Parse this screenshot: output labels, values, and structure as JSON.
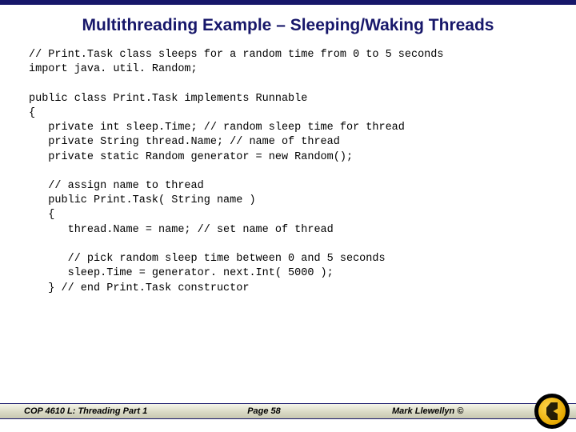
{
  "title": "Multithreading Example – Sleeping/Waking Threads",
  "code": "// Print.Task class sleeps for a random time from 0 to 5 seconds\nimport java. util. Random;\n\npublic class Print.Task implements Runnable\n{\n   private int sleep.Time; // random sleep time for thread\n   private String thread.Name; // name of thread\n   private static Random generator = new Random();\n\n   // assign name to thread\n   public Print.Task( String name )\n   {\n      thread.Name = name; // set name of thread\n\n      // pick random sleep time between 0 and 5 seconds\n      sleep.Time = generator. next.Int( 5000 );\n   } // end Print.Task constructor",
  "footer": {
    "left": "COP 4610 L: Threading Part 1",
    "center": "Page 58",
    "right": "Mark Llewellyn ©"
  }
}
